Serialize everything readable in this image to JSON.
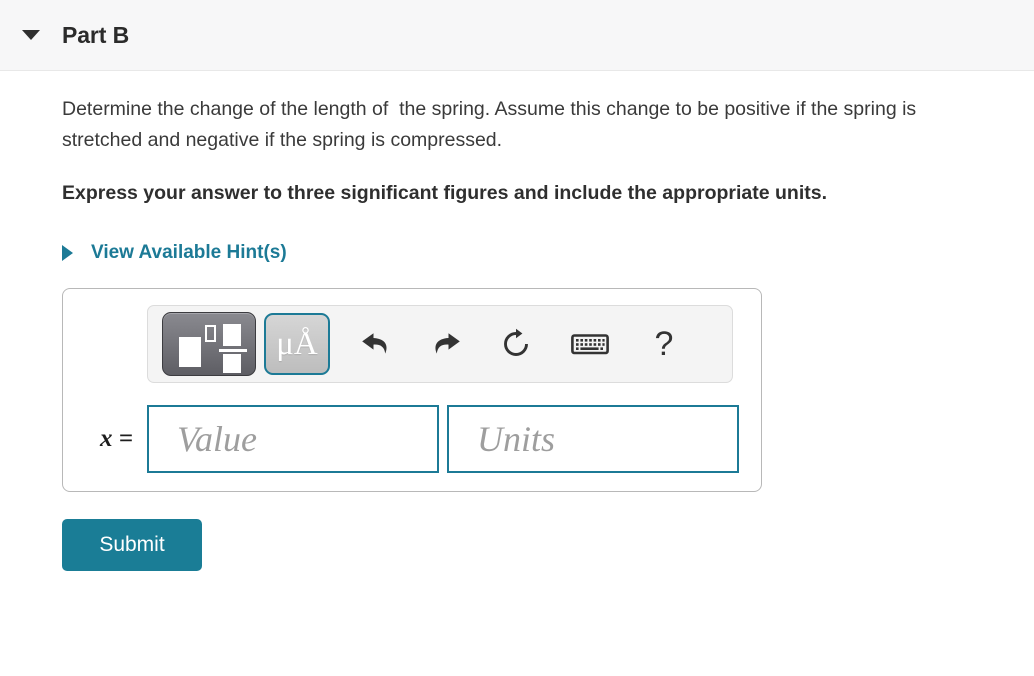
{
  "header": {
    "caret_icon": "caret-down-icon",
    "title": "Part B"
  },
  "question": {
    "prompt": "Determine the change of the length of  the spring. Assume this change to be positive if the spring is stretched and negative if the spring is compressed.",
    "instruction": "Express your answer to three significant figures and include the appropriate units."
  },
  "hints": {
    "caret_icon": "caret-right-icon",
    "label": "View Available Hint(s)"
  },
  "answer": {
    "toolbar": {
      "template_button": {
        "icon": "math-template-icon",
        "title": "Templates"
      },
      "units_button": {
        "icon": "units-icon",
        "label": "μÅ",
        "title": "Units",
        "active": true
      },
      "undo_button": {
        "icon": "undo-arrow-icon",
        "title": "Undo"
      },
      "redo_button": {
        "icon": "redo-arrow-icon",
        "title": "Redo"
      },
      "reset_button": {
        "icon": "reset-circular-arrow-icon",
        "title": "Reset"
      },
      "keyboard_button": {
        "icon": "keyboard-icon",
        "title": "Keyboard shortcuts"
      },
      "help_button": {
        "icon": "question-mark-icon",
        "label": "?",
        "title": "Help"
      }
    },
    "variable_label": "x =",
    "value_field": {
      "value": "",
      "placeholder": "Value"
    },
    "units_field": {
      "value": "",
      "placeholder": "Units"
    }
  },
  "actions": {
    "submit_label": "Submit"
  },
  "colors": {
    "accent": "#1a7d96",
    "link": "#1c7a96",
    "header_bg": "#f7f7f8",
    "toolbar_bg": "#f4f4f4",
    "text": "#3a3a3a"
  }
}
